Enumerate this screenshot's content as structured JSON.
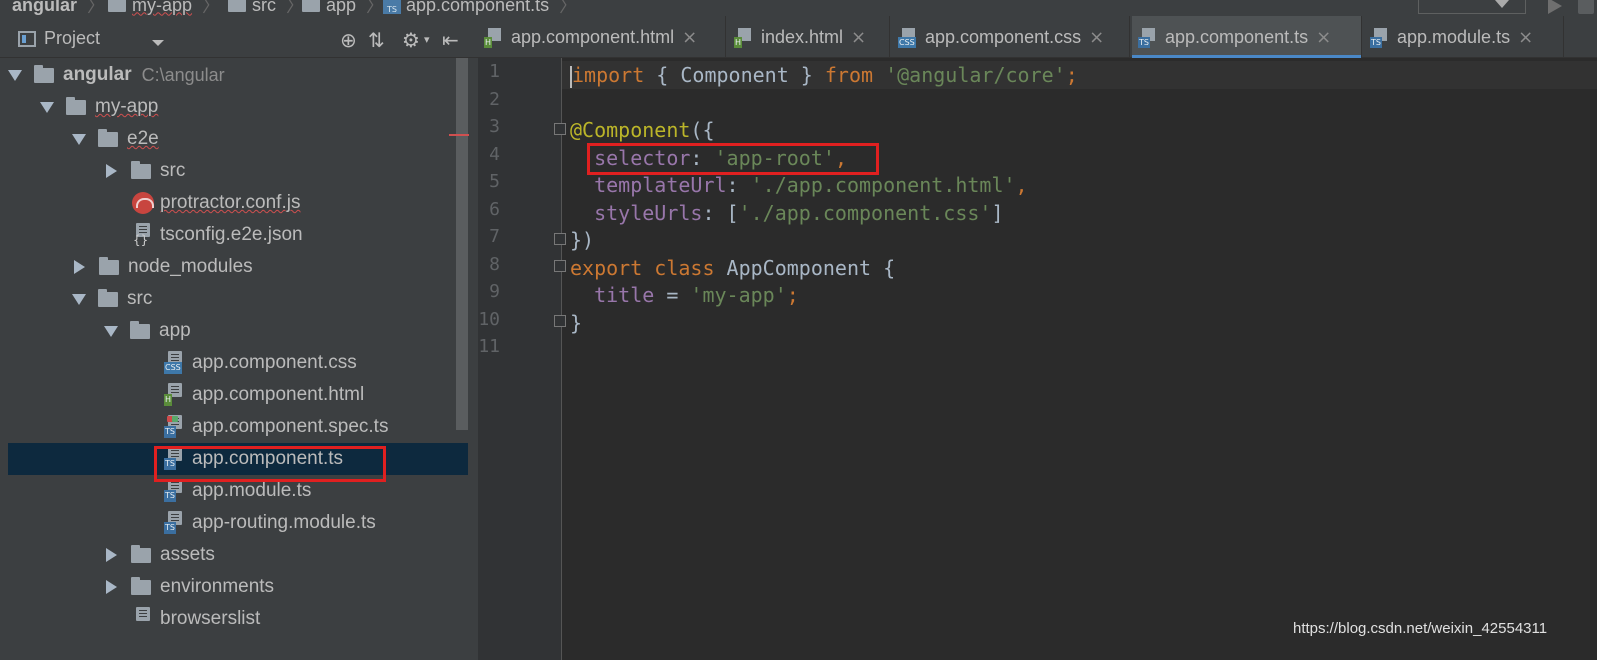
{
  "breadcrumb": {
    "items": [
      "angular",
      "my-app",
      "src",
      "app",
      "app.component.ts"
    ]
  },
  "project_panel": {
    "title": "Project",
    "tree": [
      {
        "label": "angular",
        "path": "C:\\angular",
        "type": "folder",
        "expanded": true
      },
      {
        "label": "my-app",
        "type": "folder",
        "expanded": true
      },
      {
        "label": "e2e",
        "type": "folder",
        "expanded": true
      },
      {
        "label": "src",
        "type": "folder",
        "expanded": false
      },
      {
        "label": "protractor.conf.js",
        "type": "file"
      },
      {
        "label": "tsconfig.e2e.json",
        "type": "file"
      },
      {
        "label": "node_modules",
        "type": "folder",
        "expanded": false
      },
      {
        "label": "src",
        "type": "folder",
        "expanded": true
      },
      {
        "label": "app",
        "type": "folder",
        "expanded": true
      },
      {
        "label": "app.component.css",
        "type": "file"
      },
      {
        "label": "app.component.html",
        "type": "file"
      },
      {
        "label": "app.component.spec.ts",
        "type": "file"
      },
      {
        "label": "app.component.ts",
        "type": "file",
        "selected": true
      },
      {
        "label": "app.module.ts",
        "type": "file"
      },
      {
        "label": "app-routing.module.ts",
        "type": "file"
      },
      {
        "label": "assets",
        "type": "folder",
        "expanded": false
      },
      {
        "label": "environments",
        "type": "folder",
        "expanded": false
      },
      {
        "label": "browserslist",
        "type": "file"
      }
    ]
  },
  "tabs": [
    {
      "label": "app.component.html",
      "icon": "H",
      "close": "×"
    },
    {
      "label": "index.html",
      "icon": "H",
      "close": "×"
    },
    {
      "label": "app.component.css",
      "icon": "CSS",
      "close": "×"
    },
    {
      "label": "app.component.ts",
      "icon": "TS",
      "close": "×",
      "active": true
    },
    {
      "label": "app.module.ts",
      "icon": "TS",
      "close": "×"
    }
  ],
  "editor": {
    "line_numbers": [
      "1",
      "2",
      "3",
      "4",
      "5",
      "6",
      "7",
      "8",
      "9",
      "10",
      "11"
    ],
    "code": {
      "l1_import": "import",
      "l1_mid": " { Component } ",
      "l1_from": "from",
      "l1_space": " ",
      "l1_str": "'@angular/core'",
      "l1_semi": ";",
      "l3_ann": "@Component",
      "l3_rest": "({",
      "l4_prop": "  selector",
      "l4_colon": ": ",
      "l4_str": "'app-root'",
      "l4_comma": ",",
      "l5_prop": "  templateUrl",
      "l5_colon": ": ",
      "l5_str": "'./app.component.html'",
      "l5_comma": ",",
      "l6_prop": "  styleUrls",
      "l6_colon": ": [",
      "l6_str": "'./app.component.css'",
      "l6_end": "]",
      "l7": "})",
      "l8_export": "export",
      "l8_sp": " ",
      "l8_class": "class",
      "l8_rest": " AppComponent {",
      "l9_prop": "  title",
      "l9_eq": " = ",
      "l9_str": "'my-app'",
      "l9_semi": ";",
      "l10": "}"
    }
  },
  "watermark": "https://blog.csdn.net/weixin_42554311",
  "colors": {
    "keyword": "#cc7832",
    "string": "#6a8759",
    "annotation": "#bbb529",
    "property": "#9876aa",
    "highlight_box": "#e02020"
  }
}
